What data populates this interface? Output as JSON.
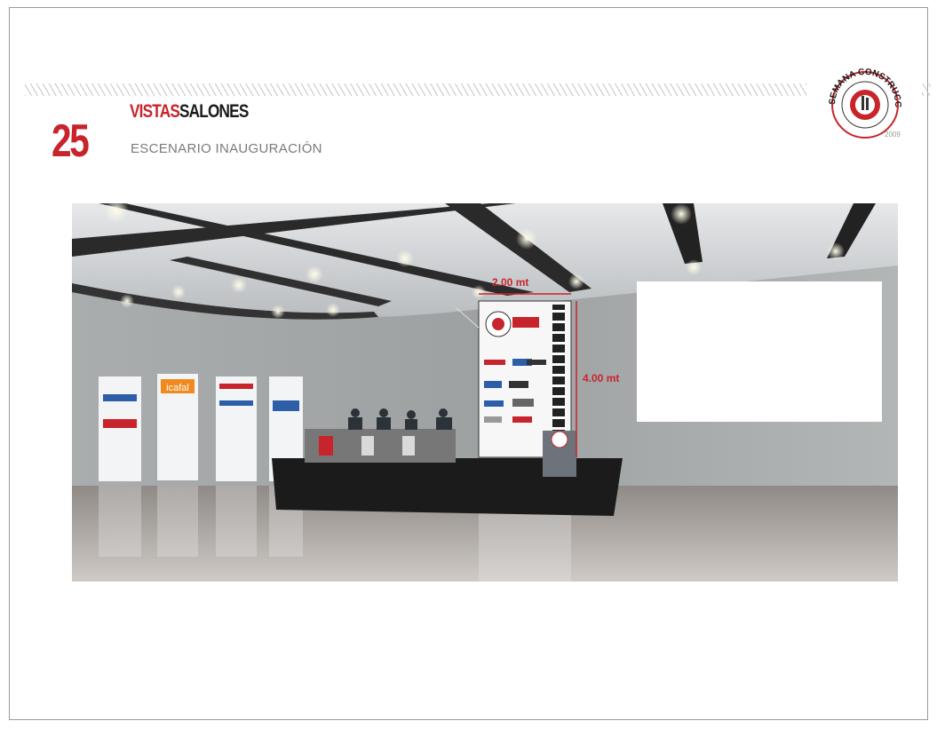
{
  "header": {
    "page_number": "25",
    "section_title_part1": "VISTAS",
    "section_title_part2": "SALONES",
    "subtitle": "ESCENARIO INAUGURACIÓN"
  },
  "logo": {
    "text_top": "SEMANA CONSTRUCCION",
    "year": "2009",
    "icon": "construction-week-seal-icon"
  },
  "render": {
    "dimension_width": "2.00 mt",
    "dimension_height": "4.00 mt",
    "banner_brands": [
      "icafal"
    ]
  },
  "colors": {
    "accent_red": "#c8242b",
    "text_gray": "#7a7a7a"
  }
}
